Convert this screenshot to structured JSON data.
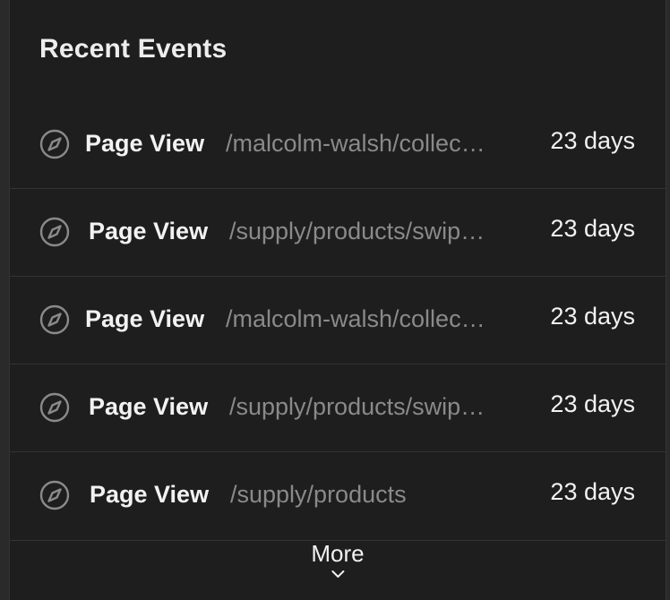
{
  "panel": {
    "title": "Recent Events"
  },
  "events": [
    {
      "icon": "compass-icon",
      "name": "Page View",
      "path": "/malcolm-walsh/collec…",
      "time": "23 days"
    },
    {
      "icon": "compass-icon",
      "name": "Page View",
      "path": "/supply/products/swip…",
      "time": "23 days"
    },
    {
      "icon": "compass-icon",
      "name": "Page View",
      "path": "/malcolm-walsh/collec…",
      "time": "23 days"
    },
    {
      "icon": "compass-icon",
      "name": "Page View",
      "path": "/supply/products/swip…",
      "time": "23 days"
    },
    {
      "icon": "compass-icon",
      "name": "Page View",
      "path": "/supply/products",
      "time": "23 days"
    }
  ],
  "more": {
    "label": "More",
    "icon": "chevron-down-icon"
  },
  "colors": {
    "background": "#1e1e1e",
    "text": "#f2f2f2",
    "muted": "#8a8a8a",
    "divider": "#333333"
  }
}
